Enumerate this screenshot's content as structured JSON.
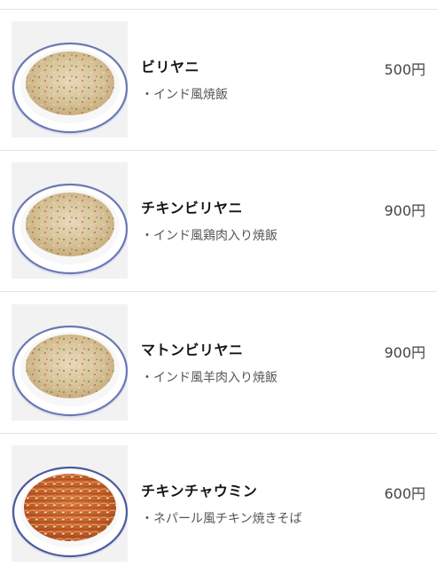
{
  "menu": {
    "items": [
      {
        "name": "ビリヤニ",
        "description": "・インド風焼飯",
        "price": "500円",
        "image": "biryani-plate-photo"
      },
      {
        "name": "チキンビリヤニ",
        "description": "・インド風鶏肉入り焼飯",
        "price": "900円",
        "image": "biryani-plate-photo"
      },
      {
        "name": "マトンビリヤニ",
        "description": "・インド風羊肉入り焼飯",
        "price": "900円",
        "image": "biryani-plate-photo"
      },
      {
        "name": "チキンチャウミン",
        "description": "・ネパール風チキン焼きそば",
        "price": "600円",
        "image": "chowmein-plate-photo"
      }
    ]
  }
}
